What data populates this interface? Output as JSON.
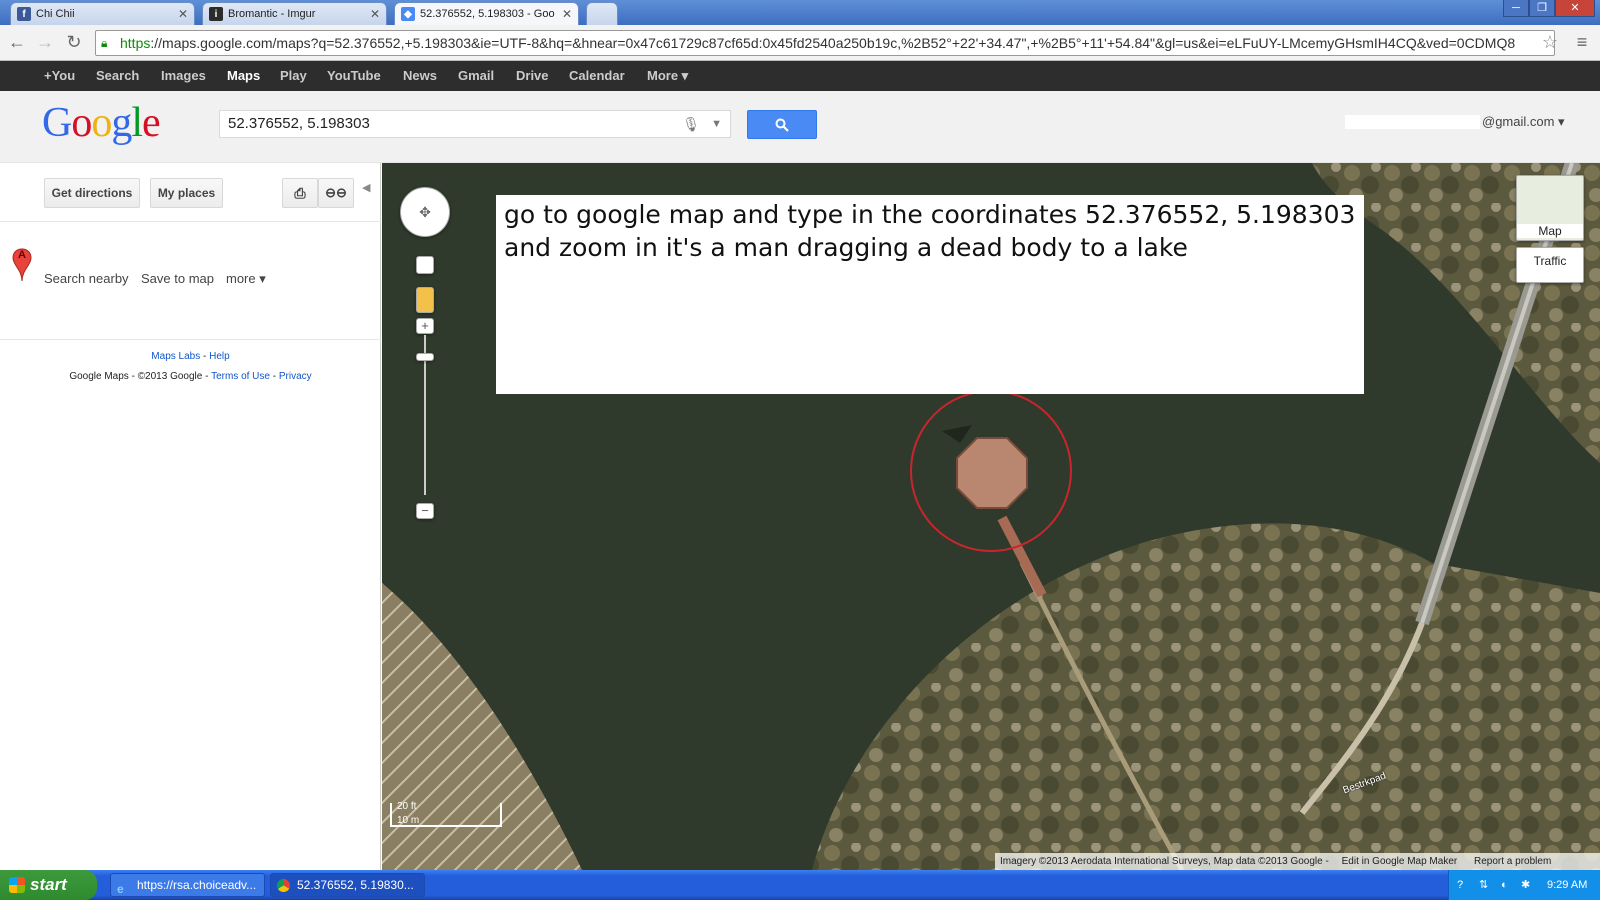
{
  "browser": {
    "tabs": [
      {
        "title": "Chi Chii",
        "icon": "facebook-icon",
        "color": "#3b5998"
      },
      {
        "title": "Bromantic - Imgur",
        "icon": "imgur-icon",
        "color": "#2b2b2b"
      },
      {
        "title": "52.376552, 5.198303 - Goo",
        "icon": "google-maps-icon",
        "color": "#4a8af4"
      }
    ],
    "url_scheme": "https",
    "url_rest": "://maps.google.com/maps?q=52.376552,+5.198303&ie=UTF-8&hq=&hnear=0x47c61729c87cf65d:0x45fd2540a250b19c,%2B52°+22'+34.47\",+%2B5°+11'+54.84\"&gl=us&ei=eLFuUY-LMcemyGHsmIH4CQ&ved=0CDMQ8"
  },
  "gbar": {
    "items": [
      "+You",
      "Search",
      "Images",
      "Maps",
      "Play",
      "YouTube",
      "News",
      "Gmail",
      "Drive",
      "Calendar",
      "More ▾"
    ],
    "selected": "Maps"
  },
  "header": {
    "search_value": "52.376552, 5.198303",
    "account": "@gmail.com ▾"
  },
  "left_panel": {
    "get_directions": "Get directions",
    "my_places": "My places",
    "marker_letter": "A",
    "search_nearby": "Search nearby",
    "save_to_map": "Save to map",
    "more": "more ▾",
    "maps_labs": "Maps Labs",
    "help": "Help",
    "copyright": "Google Maps - ©2013 Google -",
    "terms": "Terms of Use",
    "privacy": "Privacy"
  },
  "map": {
    "overlay_text_line1": "go to google map and type in the coordinates 52.376552, 5.198303",
    "overlay_text_line2": "and zoom in it's a man dragging a dead body to a lake",
    "map_button": "Map",
    "traffic_button": "Traffic",
    "scale_ft": "20 ft",
    "scale_m": "10 m",
    "road_label": "Bestrkpad",
    "attribution": "Imagery ©2013 Aerodata International Surveys, Map data ©2013 Google -",
    "edit_link": "Edit in Google Map Maker",
    "report_link": "Report a problem",
    "colors": {
      "water": "#2f3a2c",
      "circle": "#c8262c"
    }
  },
  "taskbar": {
    "start": "start",
    "tasks": [
      "https://rsa.choiceadv...",
      "52.376552, 5.19830..."
    ],
    "time": "9:29 AM"
  }
}
